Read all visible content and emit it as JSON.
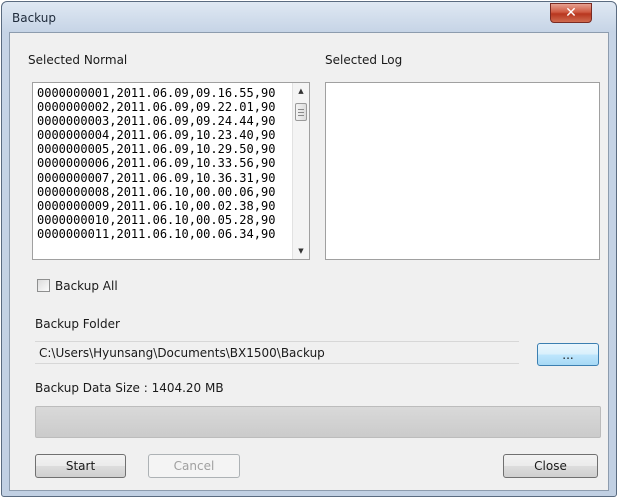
{
  "window": {
    "title": "Backup",
    "close_glyph": "✕"
  },
  "selected_normal": {
    "label": "Selected Normal",
    "items": [
      "0000000001,2011.06.09,09.16.55,90",
      "0000000002,2011.06.09,09.22.01,90",
      "0000000003,2011.06.09,09.24.44,90",
      "0000000004,2011.06.09,10.23.40,90",
      "0000000005,2011.06.09,10.29.50,90",
      "0000000006,2011.06.09,10.33.56,90",
      "0000000007,2011.06.09,10.36.31,90",
      "0000000008,2011.06.10,00.00.06,90",
      "0000000009,2011.06.10,00.02.38,90",
      "0000000010,2011.06.10,00.05.28,90",
      "0000000011,2011.06.10,00.06.34,90"
    ]
  },
  "selected_log": {
    "label": "Selected Log",
    "items": []
  },
  "backup_all": {
    "label": "Backup All",
    "checked": false
  },
  "backup_folder": {
    "label": "Backup Folder",
    "path": "C:\\Users\\Hyunsang\\Documents\\BX1500\\Backup",
    "browse_label": "..."
  },
  "data_size": {
    "text": "Backup Data Size : 1404.20 MB"
  },
  "progress": {
    "value": 0
  },
  "buttons": {
    "start": "Start",
    "cancel": "Cancel",
    "close": "Close"
  },
  "icons": {
    "close": "close-icon",
    "scroll_up": "scroll-up-arrow-icon",
    "scroll_down": "scroll-down-arrow-icon",
    "checkbox": "checkbox-icon"
  }
}
